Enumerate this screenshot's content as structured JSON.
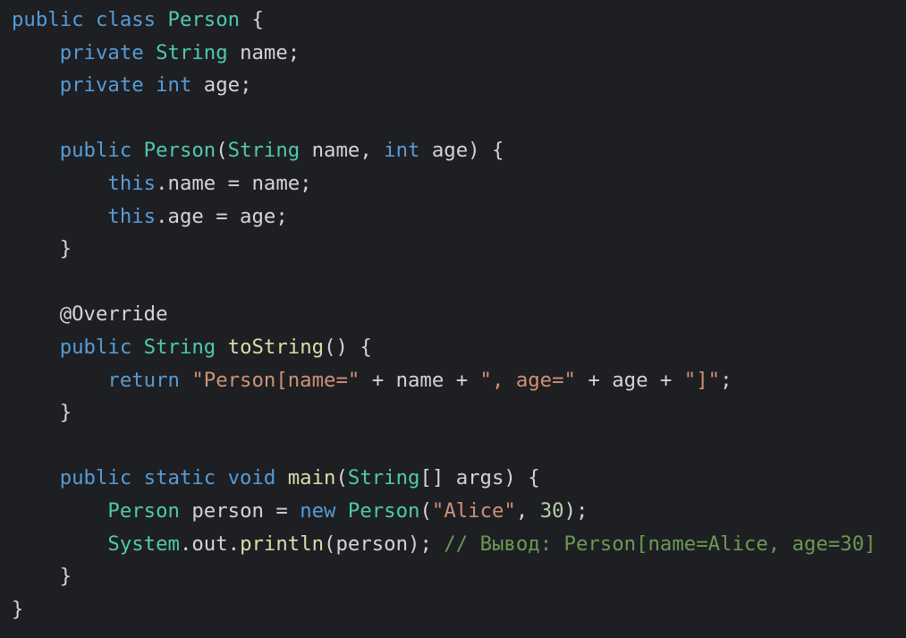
{
  "colors": {
    "background": "#1e1f22",
    "plain": "#d4d4d4",
    "keyword": "#569cd6",
    "type": "#4ec9b0",
    "method": "#dcdcaa",
    "string": "#ce9178",
    "number": "#b5cea8",
    "comment": "#6a9955",
    "annotation": "#d4d4d4"
  },
  "code": {
    "lines": [
      [
        {
          "t": "public class ",
          "k": "keyword"
        },
        {
          "t": "Person",
          "k": "type"
        },
        {
          "t": " {",
          "k": "plain"
        }
      ],
      [
        {
          "t": "    private ",
          "k": "keyword"
        },
        {
          "t": "String",
          "k": "type"
        },
        {
          "t": " name;",
          "k": "plain"
        }
      ],
      [
        {
          "t": "    private ",
          "k": "keyword"
        },
        {
          "t": "int",
          "k": "keyword"
        },
        {
          "t": " age;",
          "k": "plain"
        }
      ],
      [],
      [
        {
          "t": "    public ",
          "k": "keyword"
        },
        {
          "t": "Person",
          "k": "type"
        },
        {
          "t": "(",
          "k": "plain"
        },
        {
          "t": "String",
          "k": "type"
        },
        {
          "t": " name, ",
          "k": "plain"
        },
        {
          "t": "int",
          "k": "keyword"
        },
        {
          "t": " age) {",
          "k": "plain"
        }
      ],
      [
        {
          "t": "        this",
          "k": "keyword"
        },
        {
          "t": ".name = name;",
          "k": "plain"
        }
      ],
      [
        {
          "t": "        this",
          "k": "keyword"
        },
        {
          "t": ".age = age;",
          "k": "plain"
        }
      ],
      [
        {
          "t": "    }",
          "k": "plain"
        }
      ],
      [],
      [
        {
          "t": "    @Override",
          "k": "annotation"
        }
      ],
      [
        {
          "t": "    public ",
          "k": "keyword"
        },
        {
          "t": "String",
          "k": "type"
        },
        {
          "t": " ",
          "k": "plain"
        },
        {
          "t": "toString",
          "k": "method"
        },
        {
          "t": "() {",
          "k": "plain"
        }
      ],
      [
        {
          "t": "        return ",
          "k": "keyword"
        },
        {
          "t": "\"Person[name=\"",
          "k": "string"
        },
        {
          "t": " + name + ",
          "k": "plain"
        },
        {
          "t": "\", age=\"",
          "k": "string"
        },
        {
          "t": " + age + ",
          "k": "plain"
        },
        {
          "t": "\"]\"",
          "k": "string"
        },
        {
          "t": ";",
          "k": "plain"
        }
      ],
      [
        {
          "t": "    }",
          "k": "plain"
        }
      ],
      [],
      [
        {
          "t": "    public static void ",
          "k": "keyword"
        },
        {
          "t": "main",
          "k": "method"
        },
        {
          "t": "(",
          "k": "plain"
        },
        {
          "t": "String",
          "k": "type"
        },
        {
          "t": "[] args) {",
          "k": "plain"
        }
      ],
      [
        {
          "t": "        ",
          "k": "plain"
        },
        {
          "t": "Person",
          "k": "type"
        },
        {
          "t": " person = ",
          "k": "plain"
        },
        {
          "t": "new ",
          "k": "keyword"
        },
        {
          "t": "Person",
          "k": "type"
        },
        {
          "t": "(",
          "k": "plain"
        },
        {
          "t": "\"Alice\"",
          "k": "string"
        },
        {
          "t": ", ",
          "k": "plain"
        },
        {
          "t": "30",
          "k": "number"
        },
        {
          "t": ");",
          "k": "plain"
        }
      ],
      [
        {
          "t": "        ",
          "k": "plain"
        },
        {
          "t": "System",
          "k": "type"
        },
        {
          "t": ".out.",
          "k": "plain"
        },
        {
          "t": "println",
          "k": "method"
        },
        {
          "t": "(person); ",
          "k": "plain"
        },
        {
          "t": "// Вывод: Person[name=Alice, age=30]",
          "k": "comment"
        }
      ],
      [
        {
          "t": "    }",
          "k": "plain"
        }
      ],
      [
        {
          "t": "}",
          "k": "plain"
        }
      ]
    ]
  }
}
